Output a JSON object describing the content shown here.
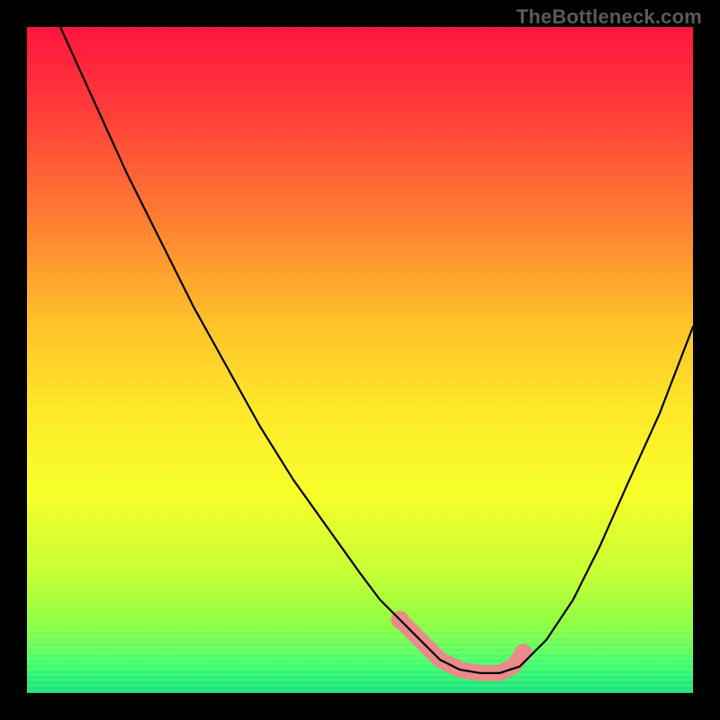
{
  "watermark": "TheBottleneck.com",
  "chart_data": {
    "type": "line",
    "title": "",
    "xlabel": "",
    "ylabel": "",
    "xlim": [
      0,
      100
    ],
    "ylim": [
      0,
      100
    ],
    "grid": false,
    "legend": false,
    "description": "Bottleneck-style V-curve over a vertical red→yellow→green gradient background. The curve drops steeply from the top-left, reaches a broad minimum around x≈62–70, then rises toward the right. A pink/salmon thick stroke highlights the flat bottom segment.",
    "background_gradient_stops": [
      {
        "pos": 0.0,
        "color": "#ff153e"
      },
      {
        "pos": 0.12,
        "color": "#ff3a3a"
      },
      {
        "pos": 0.28,
        "color": "#ff7a33"
      },
      {
        "pos": 0.45,
        "color": "#ffc42a"
      },
      {
        "pos": 0.58,
        "color": "#ffe92a"
      },
      {
        "pos": 0.7,
        "color": "#f7ff2a"
      },
      {
        "pos": 0.82,
        "color": "#c7ff35"
      },
      {
        "pos": 0.9,
        "color": "#8dff45"
      },
      {
        "pos": 0.96,
        "color": "#3eff6e"
      },
      {
        "pos": 1.0,
        "color": "#17e07a"
      }
    ],
    "series": [
      {
        "name": "bottleneck-curve",
        "color": "#000000",
        "x": [
          5,
          10,
          15,
          20,
          25,
          30,
          35,
          40,
          45,
          50,
          53,
          56,
          59,
          62,
          65,
          68,
          71,
          74,
          78,
          82,
          86,
          90,
          95,
          100
        ],
        "y": [
          100,
          89,
          78,
          68,
          58,
          49,
          40,
          32,
          25,
          18,
          14,
          11,
          8,
          5,
          3.5,
          3,
          3,
          4,
          8,
          14,
          22,
          31,
          42,
          55
        ]
      }
    ],
    "highlight": {
      "name": "bottom-flat-highlight",
      "color": "#e98b8b",
      "x": [
        56,
        59,
        62,
        65,
        68,
        71,
        73,
        74.5
      ],
      "y": [
        11,
        8,
        5,
        3.5,
        3,
        3,
        4,
        6
      ]
    }
  },
  "frame": {
    "outer_color": "#000000",
    "plot_left": 30,
    "plot_right": 770,
    "plot_top": 30,
    "plot_bottom": 770
  }
}
